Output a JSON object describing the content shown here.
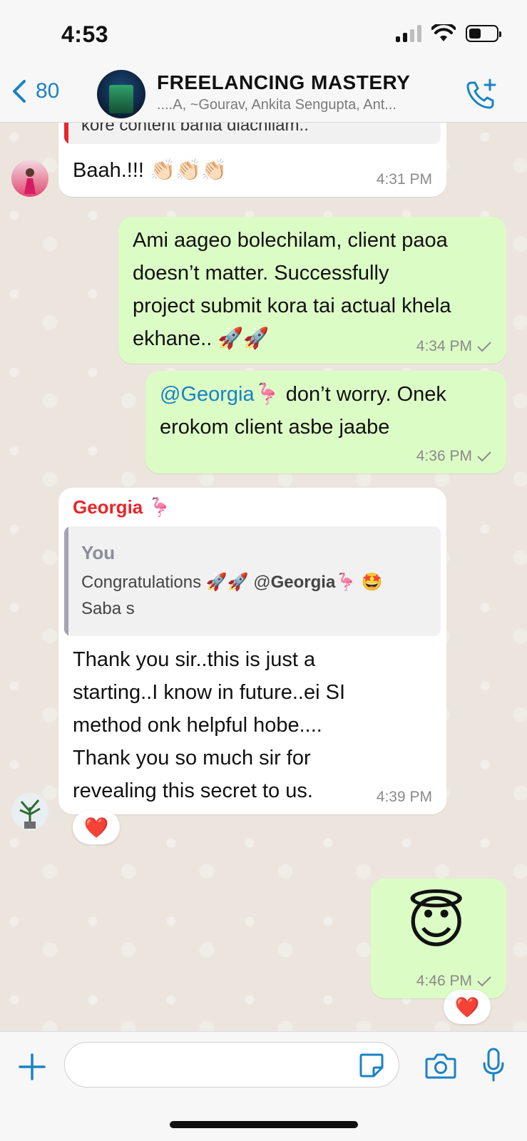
{
  "status_bar": {
    "time": "4:53"
  },
  "header": {
    "back_count": "80",
    "group_title": "FREELANCING MASTERY",
    "members": "....A, ~Gourav, Ankita Sengupta, Ant..."
  },
  "messages": [
    {
      "direction": "in",
      "quoted_tail": "kore content banla diachilam..",
      "text": "Baah.!!! 👏🏻👏🏻👏🏻",
      "time": "4:31 PM"
    },
    {
      "direction": "out",
      "text": "Ami aageo bolechilam, client paoa doesn’t matter. Successfully project submit kora tai actual khela ekhane.. 🚀🚀",
      "lines": [
        "Ami aageo bolechilam, client paoa",
        "doesn’t matter. Successfully",
        "project submit kora tai actual khela",
        "ekhane.. 🚀🚀"
      ],
      "time": "4:34 PM"
    },
    {
      "direction": "out",
      "mention": "@Georgia",
      "mention_emoji": "🦩",
      "text_line1": " don’t worry. Onek",
      "text_line2": "erokom client asbe jaabe",
      "time": "4:36 PM"
    },
    {
      "direction": "in",
      "sender": "Georgia",
      "sender_emoji": "🦩",
      "sender_color": "#e8262a",
      "quote": {
        "author": "You",
        "line1_text": "Congratulations 🚀🚀",
        "line1_mention": "@",
        "line1_mention_name": "Georgia",
        "line1_tail": "🦩 🤩",
        "line2": "Saba s",
        "bar_color": "#a7a1b7"
      },
      "lines": [
        "Thank you sir..this is just a",
        "starting..I know in future..ei SI",
        "method onk helpful hobe....",
        "Thank you so much sir for",
        "revealing this  secret to us."
      ],
      "time": "4:39 PM",
      "reaction": "❤️"
    },
    {
      "direction": "out",
      "emoji": "😇",
      "time": "4:46 PM",
      "reaction": "❤️"
    }
  ],
  "input": {
    "placeholder": ""
  },
  "colors": {
    "accent": "#1a82c4",
    "outgoing": "#dcfcc6",
    "incoming": "#ffffff",
    "chat_bg": "#ebe5dd"
  }
}
